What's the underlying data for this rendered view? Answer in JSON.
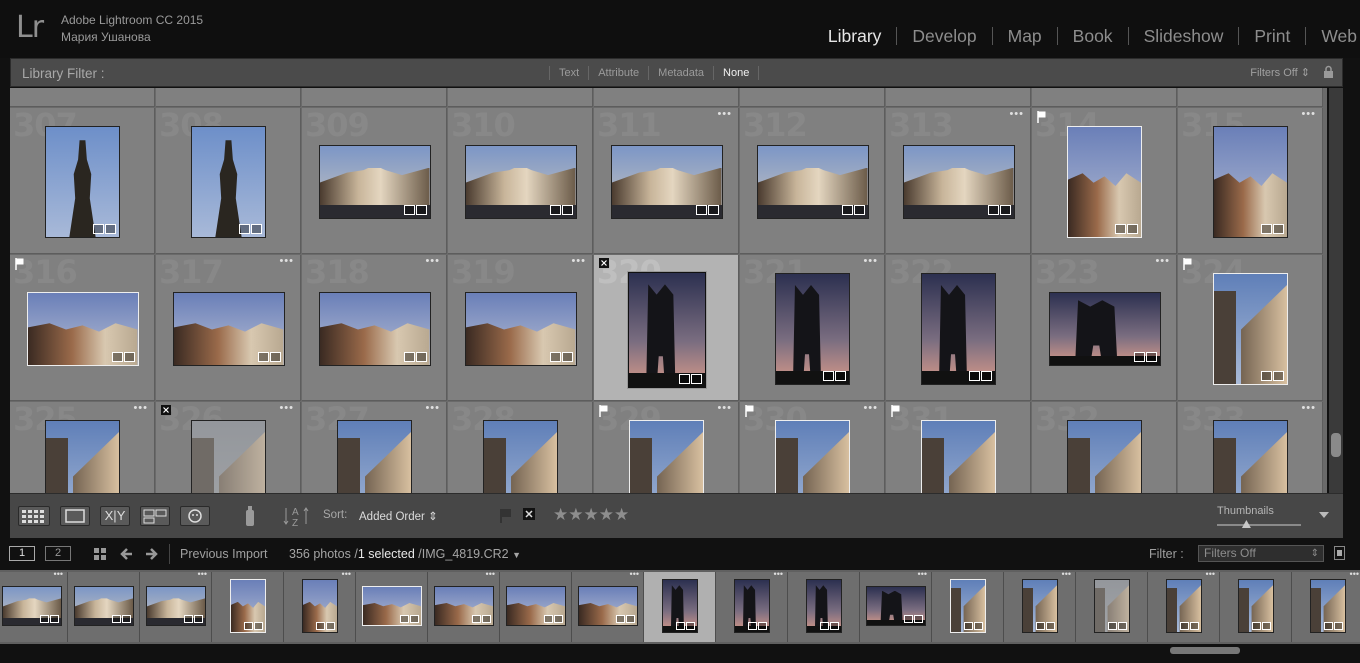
{
  "header": {
    "logo": "Lr",
    "app_name": "Adobe Lightroom CC 2015",
    "user_name": "Мария Ушанова",
    "modules": [
      {
        "label": "Library",
        "active": true
      },
      {
        "label": "Develop",
        "active": false
      },
      {
        "label": "Map",
        "active": false
      },
      {
        "label": "Book",
        "active": false
      },
      {
        "label": "Slideshow",
        "active": false
      },
      {
        "label": "Print",
        "active": false
      },
      {
        "label": "Web",
        "active": false
      }
    ]
  },
  "filter_bar": {
    "title": "Library Filter :",
    "tabs": [
      {
        "label": "Text",
        "active": false
      },
      {
        "label": "Attribute",
        "active": false
      },
      {
        "label": "Metadata",
        "active": false
      },
      {
        "label": "None",
        "active": true
      }
    ],
    "preset": "Filters Off"
  },
  "grid": {
    "rows": [
      [
        {
          "index": "307",
          "flag": "",
          "dots": false,
          "shape": "portrait",
          "scene": "statue",
          "selected": false
        },
        {
          "index": "308",
          "flag": "",
          "dots": false,
          "shape": "portrait",
          "scene": "statue",
          "selected": false
        },
        {
          "index": "309",
          "flag": "",
          "dots": false,
          "shape": "landscape",
          "scene": "church",
          "selected": false
        },
        {
          "index": "310",
          "flag": "",
          "dots": false,
          "shape": "landscape",
          "scene": "church",
          "selected": false
        },
        {
          "index": "311",
          "flag": "",
          "dots": true,
          "shape": "landscape",
          "scene": "church",
          "selected": false
        },
        {
          "index": "312",
          "flag": "",
          "dots": false,
          "shape": "landscape",
          "scene": "church",
          "selected": false
        },
        {
          "index": "313",
          "flag": "",
          "dots": true,
          "shape": "landscape",
          "scene": "church",
          "selected": false
        },
        {
          "index": "314",
          "flag": "pick",
          "dots": false,
          "shape": "portrait",
          "scene": "facade",
          "selected": false,
          "white": true
        },
        {
          "index": "315",
          "flag": "",
          "dots": true,
          "shape": "portrait",
          "scene": "facade",
          "selected": false
        }
      ],
      [
        {
          "index": "316",
          "flag": "pick",
          "dots": false,
          "shape": "landscape",
          "scene": "facade",
          "selected": false,
          "white": true
        },
        {
          "index": "317",
          "flag": "",
          "dots": true,
          "shape": "landscape",
          "scene": "facade",
          "selected": false
        },
        {
          "index": "318",
          "flag": "",
          "dots": true,
          "shape": "landscape",
          "scene": "facade",
          "selected": false
        },
        {
          "index": "319",
          "flag": "",
          "dots": true,
          "shape": "landscape",
          "scene": "facade",
          "selected": false
        },
        {
          "index": "320",
          "flag": "reject",
          "dots": false,
          "shape": "portrait",
          "scene": "tower",
          "selected": true
        },
        {
          "index": "321",
          "flag": "",
          "dots": true,
          "shape": "portrait",
          "scene": "tower",
          "selected": false
        },
        {
          "index": "322",
          "flag": "",
          "dots": false,
          "shape": "portrait",
          "scene": "tower",
          "selected": false
        },
        {
          "index": "323",
          "flag": "",
          "dots": true,
          "shape": "landscape",
          "scene": "tower",
          "selected": false
        },
        {
          "index": "324",
          "flag": "pick",
          "dots": false,
          "shape": "portrait",
          "scene": "street",
          "selected": false,
          "white": true
        }
      ],
      [
        {
          "index": "325",
          "flag": "",
          "dots": true,
          "shape": "portrait",
          "scene": "street",
          "selected": false
        },
        {
          "index": "326",
          "flag": "reject",
          "dots": true,
          "shape": "portrait",
          "scene": "street-dim",
          "selected": false
        },
        {
          "index": "327",
          "flag": "",
          "dots": true,
          "shape": "portrait",
          "scene": "street",
          "selected": false
        },
        {
          "index": "328",
          "flag": "",
          "dots": false,
          "shape": "portrait",
          "scene": "street",
          "selected": false
        },
        {
          "index": "329",
          "flag": "pick",
          "dots": true,
          "shape": "portrait",
          "scene": "street",
          "selected": false,
          "white": true
        },
        {
          "index": "330",
          "flag": "pick",
          "dots": true,
          "shape": "portrait",
          "scene": "street",
          "selected": false,
          "white": true
        },
        {
          "index": "331",
          "flag": "pick",
          "dots": false,
          "shape": "portrait",
          "scene": "street",
          "selected": false,
          "white": true
        },
        {
          "index": "332",
          "flag": "",
          "dots": false,
          "shape": "portrait",
          "scene": "street",
          "selected": false
        },
        {
          "index": "333",
          "flag": "",
          "dots": true,
          "shape": "portrait",
          "scene": "street",
          "selected": false
        }
      ]
    ]
  },
  "toolbar": {
    "sort_label": "Sort:",
    "sort_value": "Added Order",
    "stars": "★★★★★",
    "thumbnails_label": "Thumbnails",
    "thumbnail_size": 0.35
  },
  "filmstrip_bar": {
    "page_1": "1",
    "page_2": "2",
    "source": "Previous Import",
    "count": "356 photos /",
    "selected": "1 selected",
    "filename": "/IMG_4819.CR2",
    "filter_label": "Filter :",
    "filter_value": "Filters Off"
  },
  "filmstrip": [
    {
      "scene": "church",
      "shape": "landscape",
      "selected": false
    },
    {
      "scene": "church",
      "shape": "landscape",
      "selected": false
    },
    {
      "scene": "church",
      "shape": "landscape",
      "selected": false
    },
    {
      "scene": "facade",
      "shape": "portrait",
      "selected": false,
      "white": true
    },
    {
      "scene": "facade",
      "shape": "portrait",
      "selected": false
    },
    {
      "scene": "facade",
      "shape": "landscape",
      "selected": false,
      "white": true
    },
    {
      "scene": "facade",
      "shape": "landscape",
      "selected": false
    },
    {
      "scene": "facade",
      "shape": "landscape",
      "selected": false
    },
    {
      "scene": "facade",
      "shape": "landscape",
      "selected": false
    },
    {
      "scene": "tower",
      "shape": "portrait",
      "selected": true
    },
    {
      "scene": "tower",
      "shape": "portrait",
      "selected": false
    },
    {
      "scene": "tower",
      "shape": "portrait",
      "selected": false
    },
    {
      "scene": "tower",
      "shape": "landscape",
      "selected": false
    },
    {
      "scene": "street",
      "shape": "portrait",
      "selected": false,
      "white": true
    },
    {
      "scene": "street",
      "shape": "portrait",
      "selected": false
    },
    {
      "scene": "street-dim",
      "shape": "portrait",
      "selected": false
    },
    {
      "scene": "street",
      "shape": "portrait",
      "selected": false
    },
    {
      "scene": "street",
      "shape": "portrait",
      "selected": false
    },
    {
      "scene": "street",
      "shape": "portrait",
      "selected": false
    }
  ],
  "colors": {
    "accent": "#e6e6e6",
    "panel": "#474747",
    "grid_cell": "#808080",
    "selected_cell": "#b3b3b3"
  }
}
